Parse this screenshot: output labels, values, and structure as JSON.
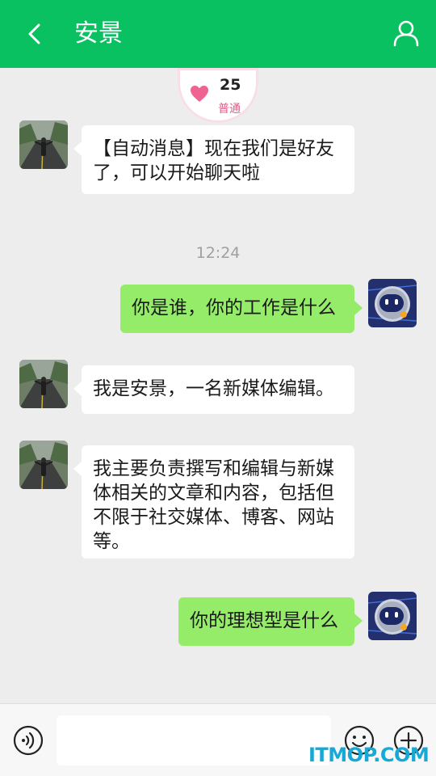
{
  "header": {
    "title": "安景",
    "back_icon": "chevron-left-icon",
    "profile_icon": "user-icon",
    "background_color": "#09c160"
  },
  "intimacy": {
    "score": "25",
    "level": "普通",
    "icon": "heart-icon",
    "heart_color": "#f06292"
  },
  "messages": [
    {
      "side": "left",
      "text": "【自动消息】现在我们是好友了，可以开始聊天啦",
      "avatar": "road-photo-avatar"
    },
    {
      "side": "right",
      "text": "你是谁，你的工作是什么",
      "avatar": "robot-avatar"
    },
    {
      "side": "left",
      "text": "我是安景，一名新媒体编辑。",
      "avatar": "road-photo-avatar"
    },
    {
      "side": "left",
      "text": "我主要负责撰写和编辑与新媒体相关的文章和内容，包括但不限于社交媒体、博客、网站等。",
      "avatar": "road-photo-avatar"
    },
    {
      "side": "right",
      "text": "你的理想型是什么",
      "avatar": "robot-avatar"
    }
  ],
  "timestamp": "12:24",
  "input_bar": {
    "voice_icon": "voice-icon",
    "input_value": "",
    "emoji_icon": "emoji-icon",
    "plus_icon": "plus-icon"
  },
  "watermark": "ITMOP.COM",
  "colors": {
    "accent": "#09c160",
    "sent_bubble": "#95ec69",
    "received_bubble": "#ffffff",
    "background": "#ededed"
  }
}
